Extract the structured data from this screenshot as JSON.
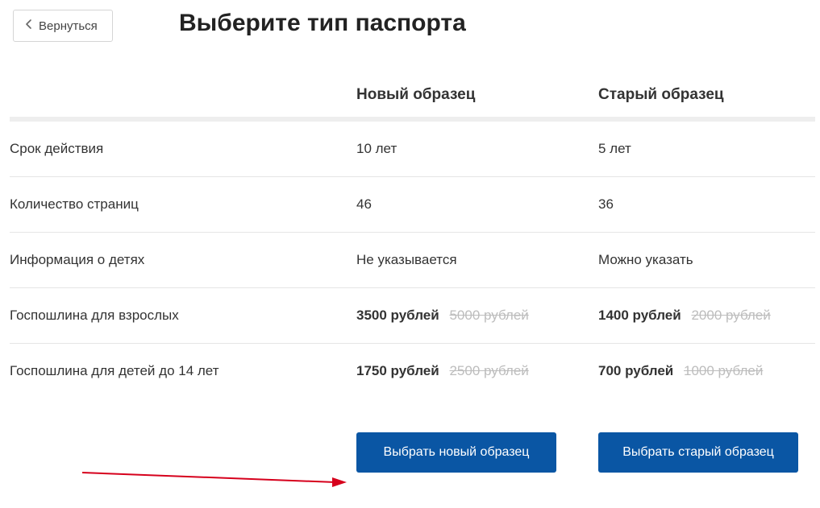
{
  "back": {
    "label": "Вернуться"
  },
  "title": "Выберите тип паспорта",
  "columns": {
    "new": "Новый образец",
    "old": "Старый образец"
  },
  "rows": {
    "validity": {
      "label": "Срок действия",
      "new": "10 лет",
      "old": "5 лет"
    },
    "pages": {
      "label": "Количество страниц",
      "new": "46",
      "old": "36"
    },
    "children": {
      "label": "Информация о детях",
      "new": "Не указывается",
      "old": "Можно указать"
    },
    "fee_adult": {
      "label": "Госпошлина для взрослых",
      "new": {
        "price": "3500 рублей",
        "old_price": "5000 рублей"
      },
      "old": {
        "price": "1400 рублей",
        "old_price": "2000 рублей"
      }
    },
    "fee_child": {
      "label": "Госпошлина для детей до 14 лет",
      "new": {
        "price": "1750 рублей",
        "old_price": "2500 рублей"
      },
      "old": {
        "price": "700 рублей",
        "old_price": "1000 рублей"
      }
    }
  },
  "actions": {
    "choose_new": "Выбрать новый образец",
    "choose_old": "Выбрать старый образец"
  }
}
